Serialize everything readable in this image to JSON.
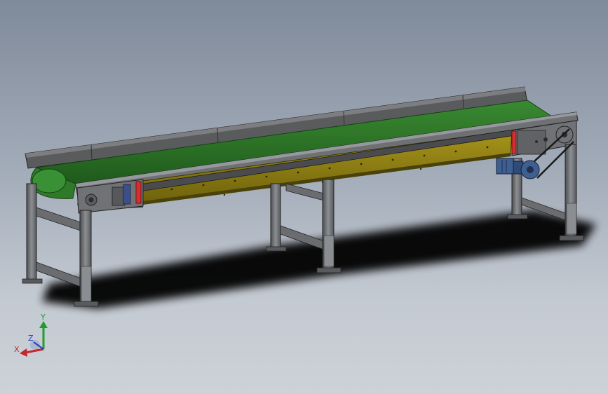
{
  "view": {
    "model": "belt-conveyor-assembly"
  },
  "triad": {
    "x_label": "X",
    "y_label": "Y",
    "z_label": "Z",
    "x_color": "#c1272d",
    "y_color": "#1e9e2c",
    "z_color": "#2a3fbf"
  },
  "model": {
    "belt_color": "#2f7a2a",
    "side_panel_color": "#8f7f12",
    "frame_color": "#6b6d70",
    "guard_color": "#5e5f61",
    "stop_color": "#d32f2f",
    "motor_color": "#3e5f8f",
    "bearing_color": "#3d4f8a"
  }
}
